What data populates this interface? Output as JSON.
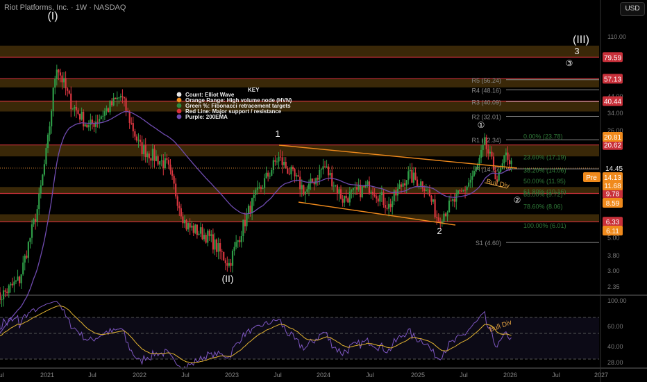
{
  "header": {
    "title": "Riot Platforms, Inc. · 1W · NASDAQ",
    "currency": "USD"
  },
  "legend": {
    "title": "KEY",
    "items": [
      {
        "label": "Count: Elliot Wave",
        "color": "#e8e8e8"
      },
      {
        "label": "Orange Range: High volume node (HVN)",
        "color": "#f08a1c"
      },
      {
        "label": "Green %: Fibonacci retracement targets",
        "color": "#2e8b3e"
      },
      {
        "label": "Red Line: Major support / resistance",
        "color": "#d9303a"
      },
      {
        "label": "Purple: 200EMA",
        "color": "#6f4bb0"
      }
    ]
  },
  "chart_data": {
    "type": "candlestick",
    "price_scale": "log",
    "x_ticks": [
      "Jul",
      "2021",
      "Jul",
      "2022",
      "Jul",
      "2023",
      "Jul",
      "2024",
      "Jul",
      "2025",
      "Jul",
      "2026",
      "Jul",
      "2027"
    ],
    "y_ticks": [
      "110.00",
      "44.00",
      "34.00",
      "26.00",
      "5.00",
      "3.80",
      "3.00",
      "2.35"
    ],
    "price_path": [
      [
        2020.45,
        1.9
      ],
      [
        2020.7,
        2.6
      ],
      [
        2020.9,
        8
      ],
      [
        2021.0,
        20
      ],
      [
        2021.1,
        72
      ],
      [
        2021.25,
        40
      ],
      [
        2021.45,
        27
      ],
      [
        2021.8,
        44
      ],
      [
        2022.0,
        20
      ],
      [
        2022.3,
        15
      ],
      [
        2022.5,
        6
      ],
      [
        2022.75,
        5
      ],
      [
        2022.97,
        3.3
      ],
      [
        2023.2,
        8
      ],
      [
        2023.5,
        17
      ],
      [
        2023.8,
        10
      ],
      [
        2024.0,
        15
      ],
      [
        2024.2,
        9
      ],
      [
        2024.5,
        11
      ],
      [
        2024.7,
        8
      ],
      [
        2024.9,
        13
      ],
      [
        2025.1,
        11
      ],
      [
        2025.23,
        6.6
      ],
      [
        2025.5,
        10
      ],
      [
        2025.65,
        14
      ],
      [
        2025.74,
        21
      ],
      [
        2025.88,
        12
      ],
      [
        2025.98,
        18
      ],
      [
        2026.04,
        14.45
      ]
    ],
    "red_lines": [
      {
        "value": 79.59,
        "label": "79.59"
      },
      {
        "value": 57.13,
        "label": "57.13"
      },
      {
        "value": 40.44,
        "label": "40.44"
      },
      {
        "value": 20.62,
        "label": "20.62"
      },
      {
        "value": 9.78,
        "label": "9.78"
      },
      {
        "value": 6.33,
        "label": "6.33"
      }
    ],
    "hvn_ranges": [
      [
        79.59,
        95
      ],
      [
        50,
        57.13
      ],
      [
        40.44,
        34.5
      ],
      [
        20.62,
        17.3
      ],
      [
        9.78,
        10.8
      ],
      [
        6.33,
        7.1
      ]
    ],
    "orange_labels": [
      {
        "label": "20.81"
      },
      {
        "label": "11.68"
      },
      {
        "label": "8.59"
      },
      {
        "label": "6.11"
      }
    ],
    "pre_label": {
      "tag": "Pre",
      "value": "14.13"
    },
    "last_price": "14.45",
    "pivots": [
      {
        "label": "R5 (56.24)",
        "value": 56.24
      },
      {
        "label": "R4 (48.16)",
        "value": 48.16
      },
      {
        "label": "R3 (40.09)",
        "value": 40.09
      },
      {
        "label": "R2 (32.01)",
        "value": 32.01
      },
      {
        "label": "R1 (22.34)",
        "value": 22.34
      },
      {
        "label": "P (14.27)",
        "value": 14.27
      },
      {
        "label": "S1 (4.60)",
        "value": 4.6
      }
    ],
    "fib": [
      {
        "label": "0.00% (23.78)",
        "value": 23.78
      },
      {
        "label": "23.60% (17.19)",
        "value": 17.19
      },
      {
        "label": "38.20% (14.06)",
        "value": 14.06
      },
      {
        "label": "50.00% (11.95)",
        "value": 11.95
      },
      {
        "label": "61.80% (10.16)",
        "value": 10.16
      },
      {
        "label": "65.00% (9.72)",
        "value": 9.72
      },
      {
        "label": "78.60% (8.06)",
        "value": 8.06
      },
      {
        "label": "100.00% (6.01)",
        "value": 6.01
      }
    ],
    "waves": [
      {
        "label": "(I)"
      },
      {
        "label": "(II)"
      },
      {
        "label": "(III)"
      },
      {
        "label": "1"
      },
      {
        "label": "2"
      },
      {
        "label": "3"
      },
      {
        "label": "①"
      },
      {
        "label": "②"
      },
      {
        "label": "③"
      }
    ],
    "annotations": {
      "bull_div_price": "Bull Div",
      "bull_div_rsi": "Bull Div"
    },
    "rsi": {
      "y_ticks": [
        "100.00",
        "60.00",
        "40.00",
        "28.00"
      ]
    }
  }
}
